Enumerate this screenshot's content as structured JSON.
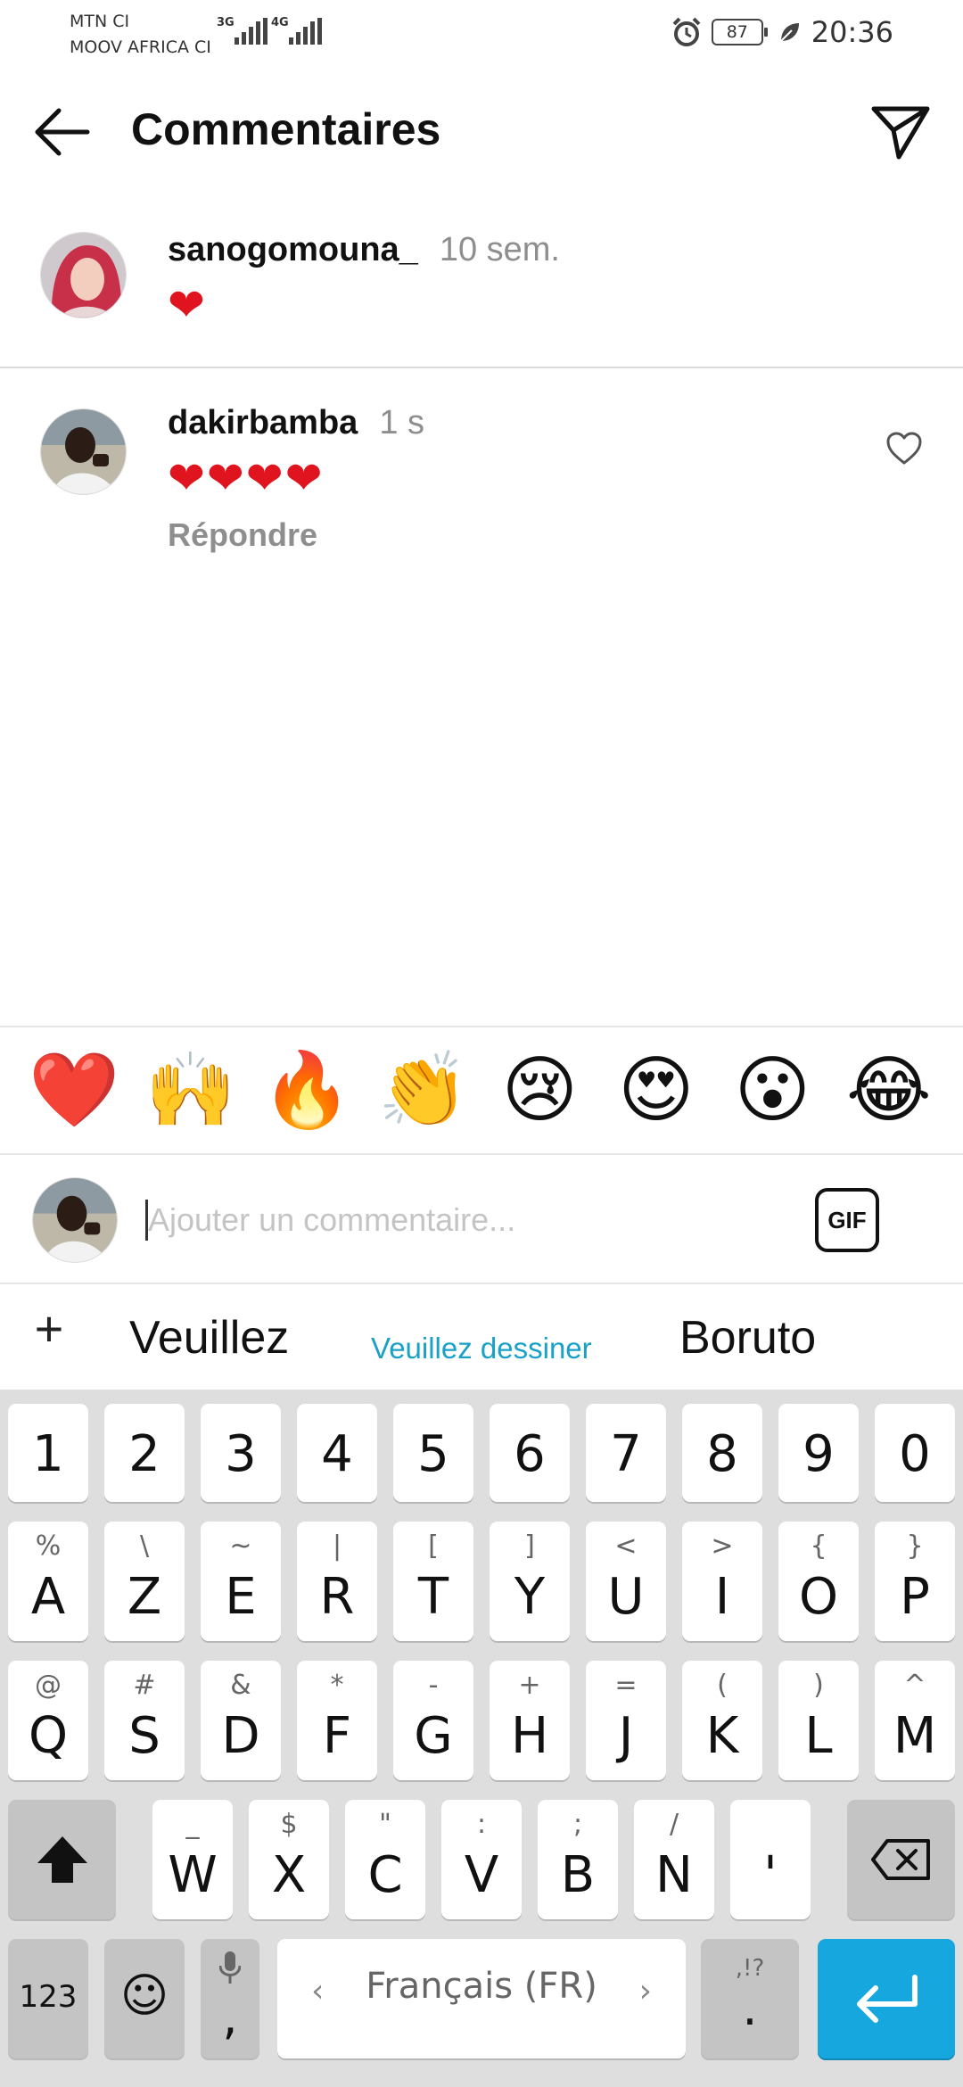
{
  "status_bar": {
    "carrier1": "MTN CI",
    "carrier2": "MOOV AFRICA CI",
    "network1": "3G",
    "network2": "4G",
    "battery": "87",
    "time": "20:36"
  },
  "header": {
    "title": "Commentaires"
  },
  "comments": [
    {
      "username": "sanogomouna_",
      "time": "10 sem.",
      "text": "❤"
    },
    {
      "username": "dakirbamba",
      "time": "1 s",
      "text": "❤❤❤❤",
      "reply_label": "Répondre"
    }
  ],
  "emoji_bar": [
    "❤️",
    "🙌",
    "🔥",
    "👏",
    "😢",
    "😍",
    "😮",
    "😂"
  ],
  "input": {
    "placeholder": "Ajouter un commentaire...",
    "gif_label": "GIF"
  },
  "suggestions": {
    "plus": "+",
    "items": [
      "Veuillez",
      "Veuillez dessiner",
      "Boruto"
    ]
  },
  "keyboard": {
    "row1": [
      "1",
      "2",
      "3",
      "4",
      "5",
      "6",
      "7",
      "8",
      "9",
      "0"
    ],
    "row2": [
      {
        "main": "A",
        "sub": "%"
      },
      {
        "main": "Z",
        "sub": "\\"
      },
      {
        "main": "E",
        "sub": "~"
      },
      {
        "main": "R",
        "sub": "|"
      },
      {
        "main": "T",
        "sub": "["
      },
      {
        "main": "Y",
        "sub": "]"
      },
      {
        "main": "U",
        "sub": "<"
      },
      {
        "main": "I",
        "sub": ">"
      },
      {
        "main": "O",
        "sub": "{"
      },
      {
        "main": "P",
        "sub": "}"
      }
    ],
    "row3": [
      {
        "main": "Q",
        "sub": "@"
      },
      {
        "main": "S",
        "sub": "#"
      },
      {
        "main": "D",
        "sub": "&"
      },
      {
        "main": "F",
        "sub": "*"
      },
      {
        "main": "G",
        "sub": "-"
      },
      {
        "main": "H",
        "sub": "+"
      },
      {
        "main": "J",
        "sub": "="
      },
      {
        "main": "K",
        "sub": "("
      },
      {
        "main": "L",
        "sub": ")"
      },
      {
        "main": "M",
        "sub": "^"
      }
    ],
    "row4": [
      {
        "main": "W",
        "sub": "_"
      },
      {
        "main": "X",
        "sub": "$"
      },
      {
        "main": "C",
        "sub": "\""
      },
      {
        "main": "V",
        "sub": ":"
      },
      {
        "main": "B",
        "sub": ";"
      },
      {
        "main": "N",
        "sub": "/"
      },
      {
        "main": "'",
        "sub": ""
      }
    ],
    "shift_icon": "shift-icon",
    "backspace_icon": "backspace-icon",
    "numbers_label": "123",
    "emoji_key": "☺",
    "comma_label": ",",
    "space_label": "Français (FR)",
    "punct_sub": ",!?",
    "punct_main": ".",
    "enter_icon": "enter-icon"
  },
  "colors": {
    "accent": "#16a7de",
    "heart": "#e0141e",
    "muted_text": "#8e8e8e",
    "suggestion_highlight": "#1aa1c8"
  }
}
